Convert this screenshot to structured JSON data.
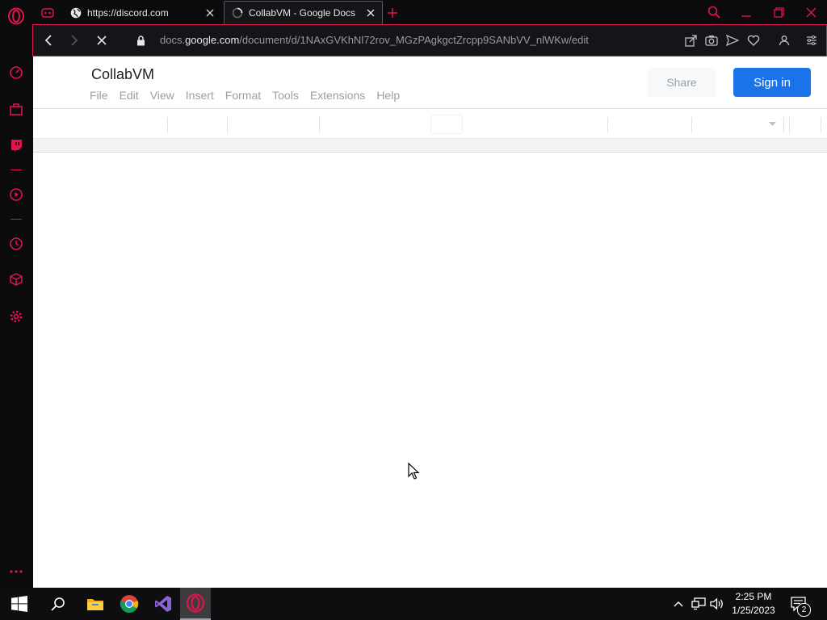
{
  "browser": {
    "tabs": [
      {
        "title": "https://discord.com",
        "active": false
      },
      {
        "title": "CollabVM - Google Docs",
        "active": true,
        "loading": true
      }
    ],
    "address": {
      "prefix": "docs.",
      "host": "google.com",
      "path": "/document/d/1NAxGVKhNl72rov_MGzPAgkgctZrcpp9SANbVV_nlWKw/edit"
    },
    "accent_color": "#e0144c"
  },
  "sidebar": {
    "icons": [
      "opera-logo-icon",
      "speed-dial-icon",
      "shopping-icon",
      "twitch-icon",
      "player-icon",
      "history-icon",
      "extensions-icon",
      "settings-icon",
      "more-icon"
    ]
  },
  "docs": {
    "title": "CollabVM",
    "menu": [
      "File",
      "Edit",
      "View",
      "Insert",
      "Format",
      "Tools",
      "Extensions",
      "Help"
    ],
    "share_label": "Share",
    "signin_label": "Sign in",
    "signin_color": "#1a73e8"
  },
  "taskbar": {
    "apps": [
      "start-icon",
      "search-icon",
      "file-explorer-icon",
      "chrome-icon",
      "visual-studio-icon",
      "opera-icon"
    ],
    "time": "2:25 PM",
    "date": "1/25/2023",
    "notifications": "2"
  }
}
